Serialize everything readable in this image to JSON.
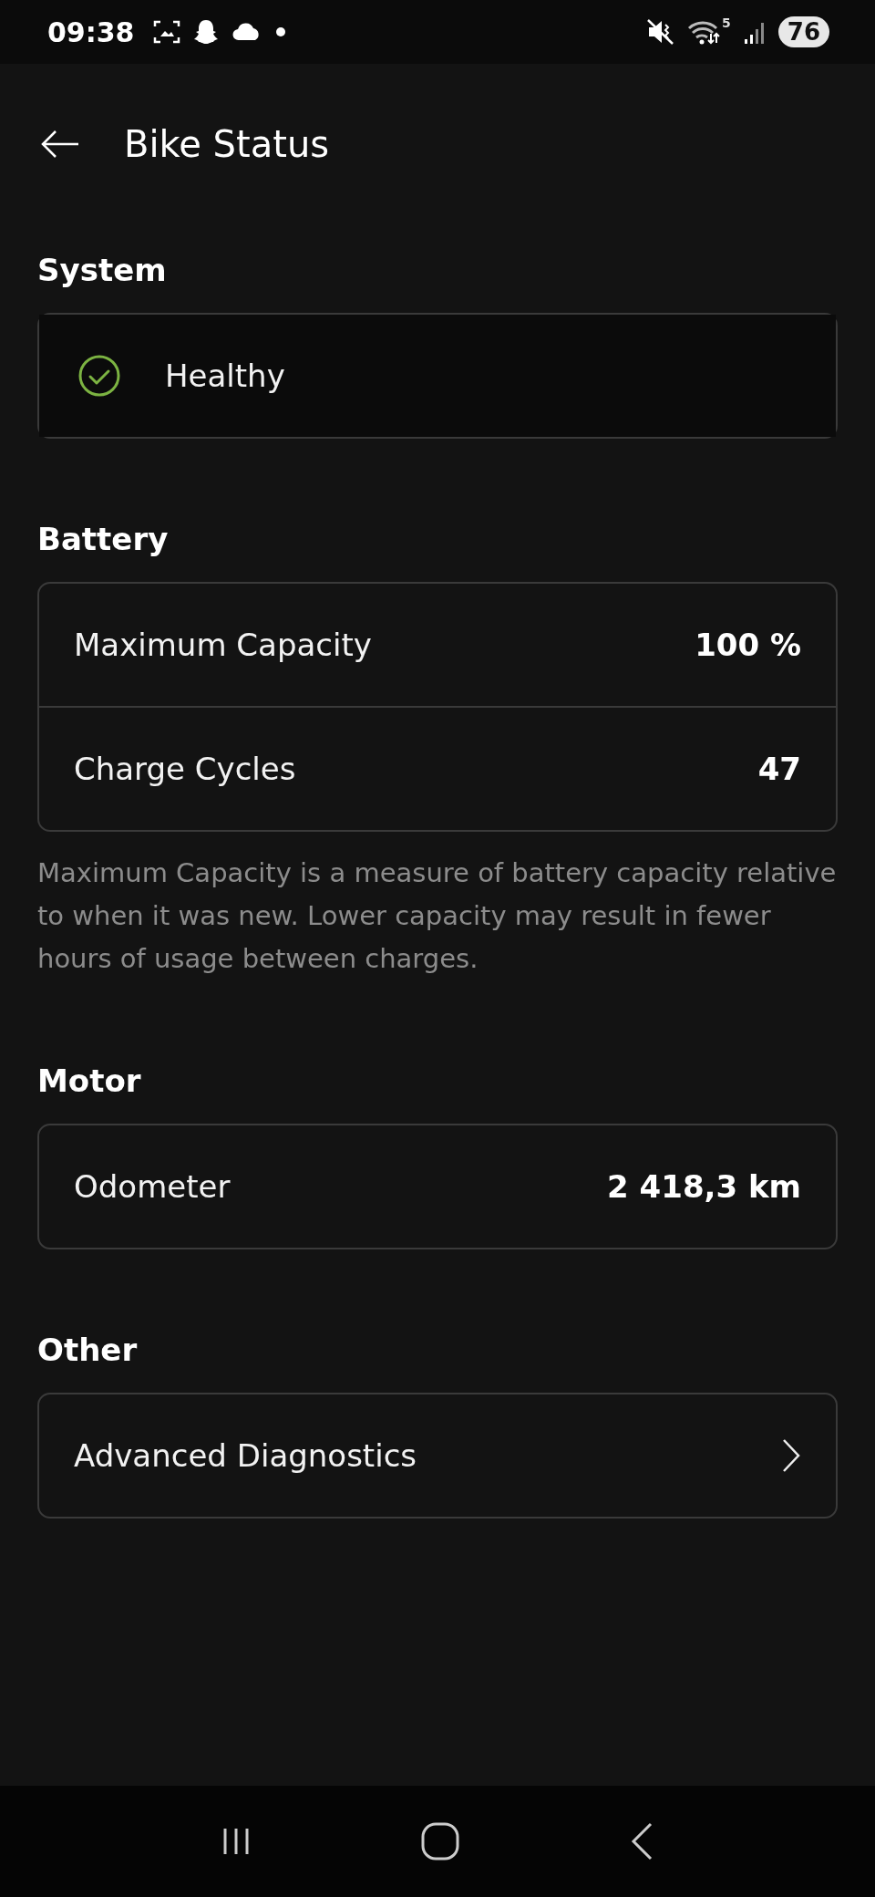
{
  "status_bar": {
    "time": "09:38",
    "wifi_band": "5",
    "battery": "76"
  },
  "header": {
    "title": "Bike Status"
  },
  "sections": [
    {
      "title": "System",
      "rows": [
        {
          "kind": "status",
          "label": "Healthy"
        }
      ]
    },
    {
      "title": "Battery",
      "rows": [
        {
          "kind": "value",
          "label": "Maximum Capacity",
          "value": "100 %"
        },
        {
          "kind": "value",
          "label": "Charge Cycles",
          "value": "47"
        }
      ],
      "note": "Maximum Capacity is a measure of battery capacity relative to when it was new. Lower capacity may result in fewer hours of usage between charges."
    },
    {
      "title": "Motor",
      "rows": [
        {
          "kind": "value",
          "label": "Odometer",
          "value": "2 418,3 km"
        }
      ]
    },
    {
      "title": "Other",
      "rows": [
        {
          "kind": "link",
          "label": "Advanced Diagnostics"
        }
      ]
    }
  ]
}
